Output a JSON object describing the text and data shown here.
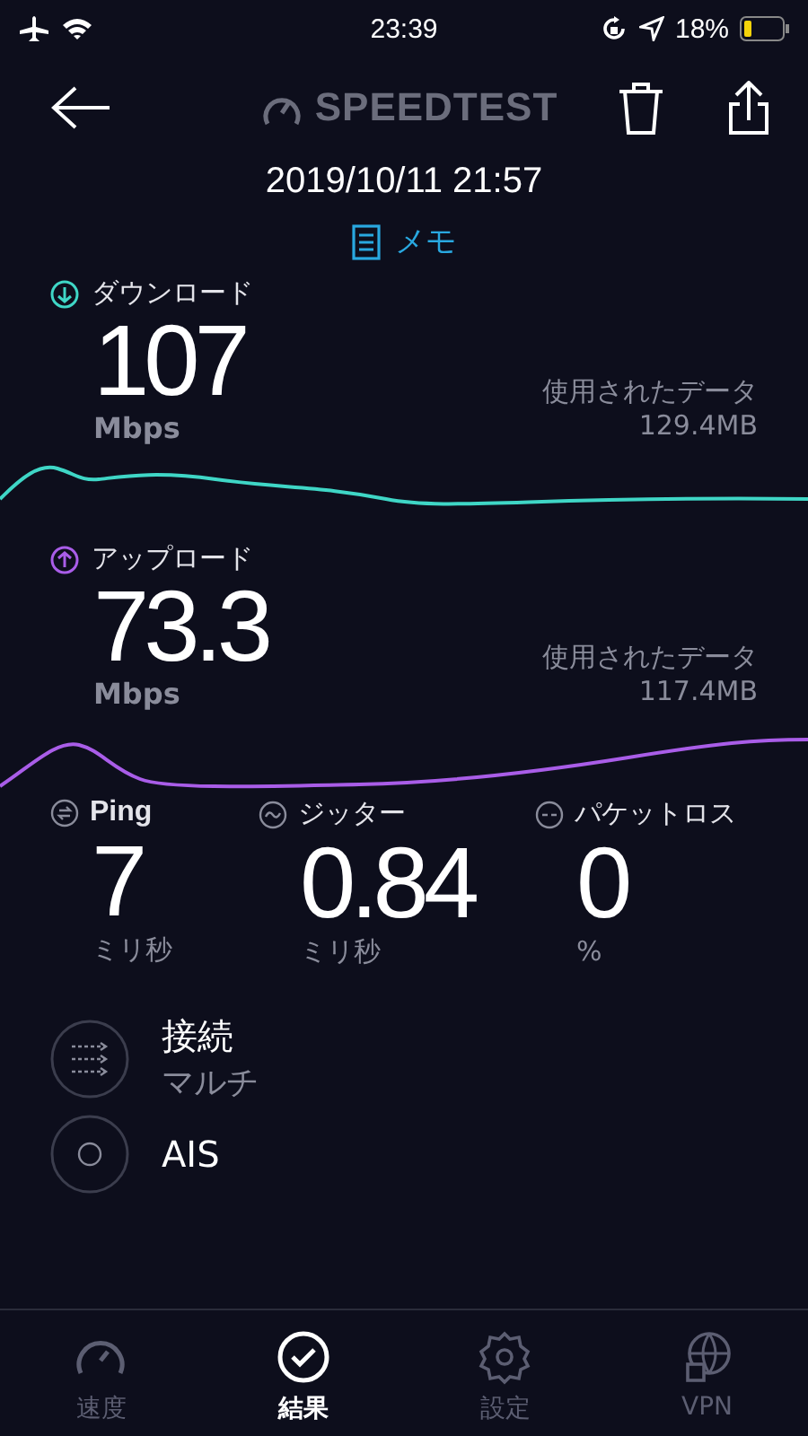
{
  "status_bar": {
    "time": "23:39",
    "battery": "18%"
  },
  "header": {
    "logo": "SPEEDTEST"
  },
  "date": "2019/10/11 21:57",
  "memo": "メモ",
  "speeds": [
    {
      "kind": "download",
      "label": "ダウンロード",
      "value": "107",
      "unit": "Mbps",
      "data_label": "使用されたデータ",
      "data_value": "129.4MB",
      "color": "#3fd6c6"
    },
    {
      "kind": "upload",
      "label": "アップロード",
      "value": "73.3",
      "unit": "Mbps",
      "data_label": "使用されたデータ",
      "data_value": "117.4MB",
      "color": "#a95de8"
    }
  ],
  "stats": [
    {
      "kind": "ping",
      "label": "Ping",
      "value": "7",
      "unit": "ミリ秒"
    },
    {
      "kind": "jitter",
      "label": "ジッター",
      "value": "0.84",
      "unit": "ミリ秒"
    },
    {
      "kind": "loss",
      "label": "パケットロス",
      "value": "0",
      "unit": "%"
    }
  ],
  "details": [
    {
      "kind": "connection",
      "title": "接続",
      "value": "マルチ"
    },
    {
      "kind": "provider",
      "title": "AIS"
    }
  ],
  "tabs": [
    {
      "kind": "speed",
      "label": "速度",
      "selected": false
    },
    {
      "kind": "results",
      "label": "結果",
      "selected": true
    },
    {
      "kind": "settings",
      "label": "設定",
      "selected": false
    },
    {
      "kind": "vpn",
      "label": "VPN",
      "selected": false
    }
  ]
}
